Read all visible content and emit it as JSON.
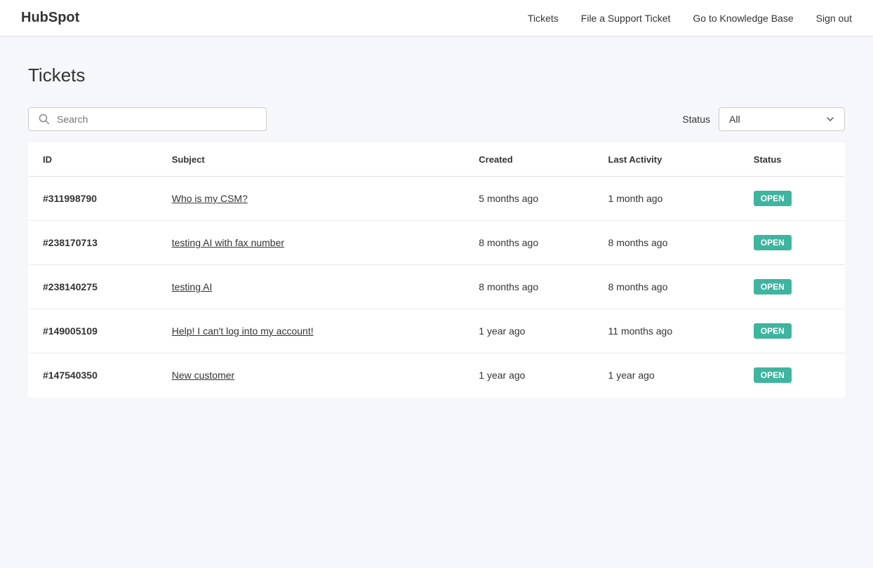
{
  "header": {
    "logo": "HubSpot",
    "nav": {
      "tickets_label": "Tickets",
      "file_support_label": "File a Support Ticket",
      "knowledge_base_label": "Go to Knowledge Base",
      "sign_out_label": "Sign out"
    }
  },
  "page": {
    "title": "Tickets"
  },
  "toolbar": {
    "search_placeholder": "Search",
    "status_label": "Status",
    "status_value": "All"
  },
  "table": {
    "columns": {
      "id": "ID",
      "subject": "Subject",
      "created": "Created",
      "last_activity": "Last Activity",
      "status": "Status"
    },
    "rows": [
      {
        "id": "#311998790",
        "subject": "Who is my CSM?",
        "created": "5 months ago",
        "last_activity": "1 month ago",
        "status": "OPEN"
      },
      {
        "id": "#238170713",
        "subject": "testing AI with fax number",
        "created": "8 months ago",
        "last_activity": "8 months ago",
        "status": "OPEN"
      },
      {
        "id": "#238140275",
        "subject": "testing AI",
        "created": "8 months ago",
        "last_activity": "8 months ago",
        "status": "OPEN"
      },
      {
        "id": "#149005109",
        "subject": "Help! I can't log into my account!",
        "created": "1 year ago",
        "last_activity": "11 months ago",
        "status": "OPEN"
      },
      {
        "id": "#147540350",
        "subject": "New customer",
        "created": "1 year ago",
        "last_activity": "1 year ago",
        "status": "OPEN"
      }
    ]
  }
}
